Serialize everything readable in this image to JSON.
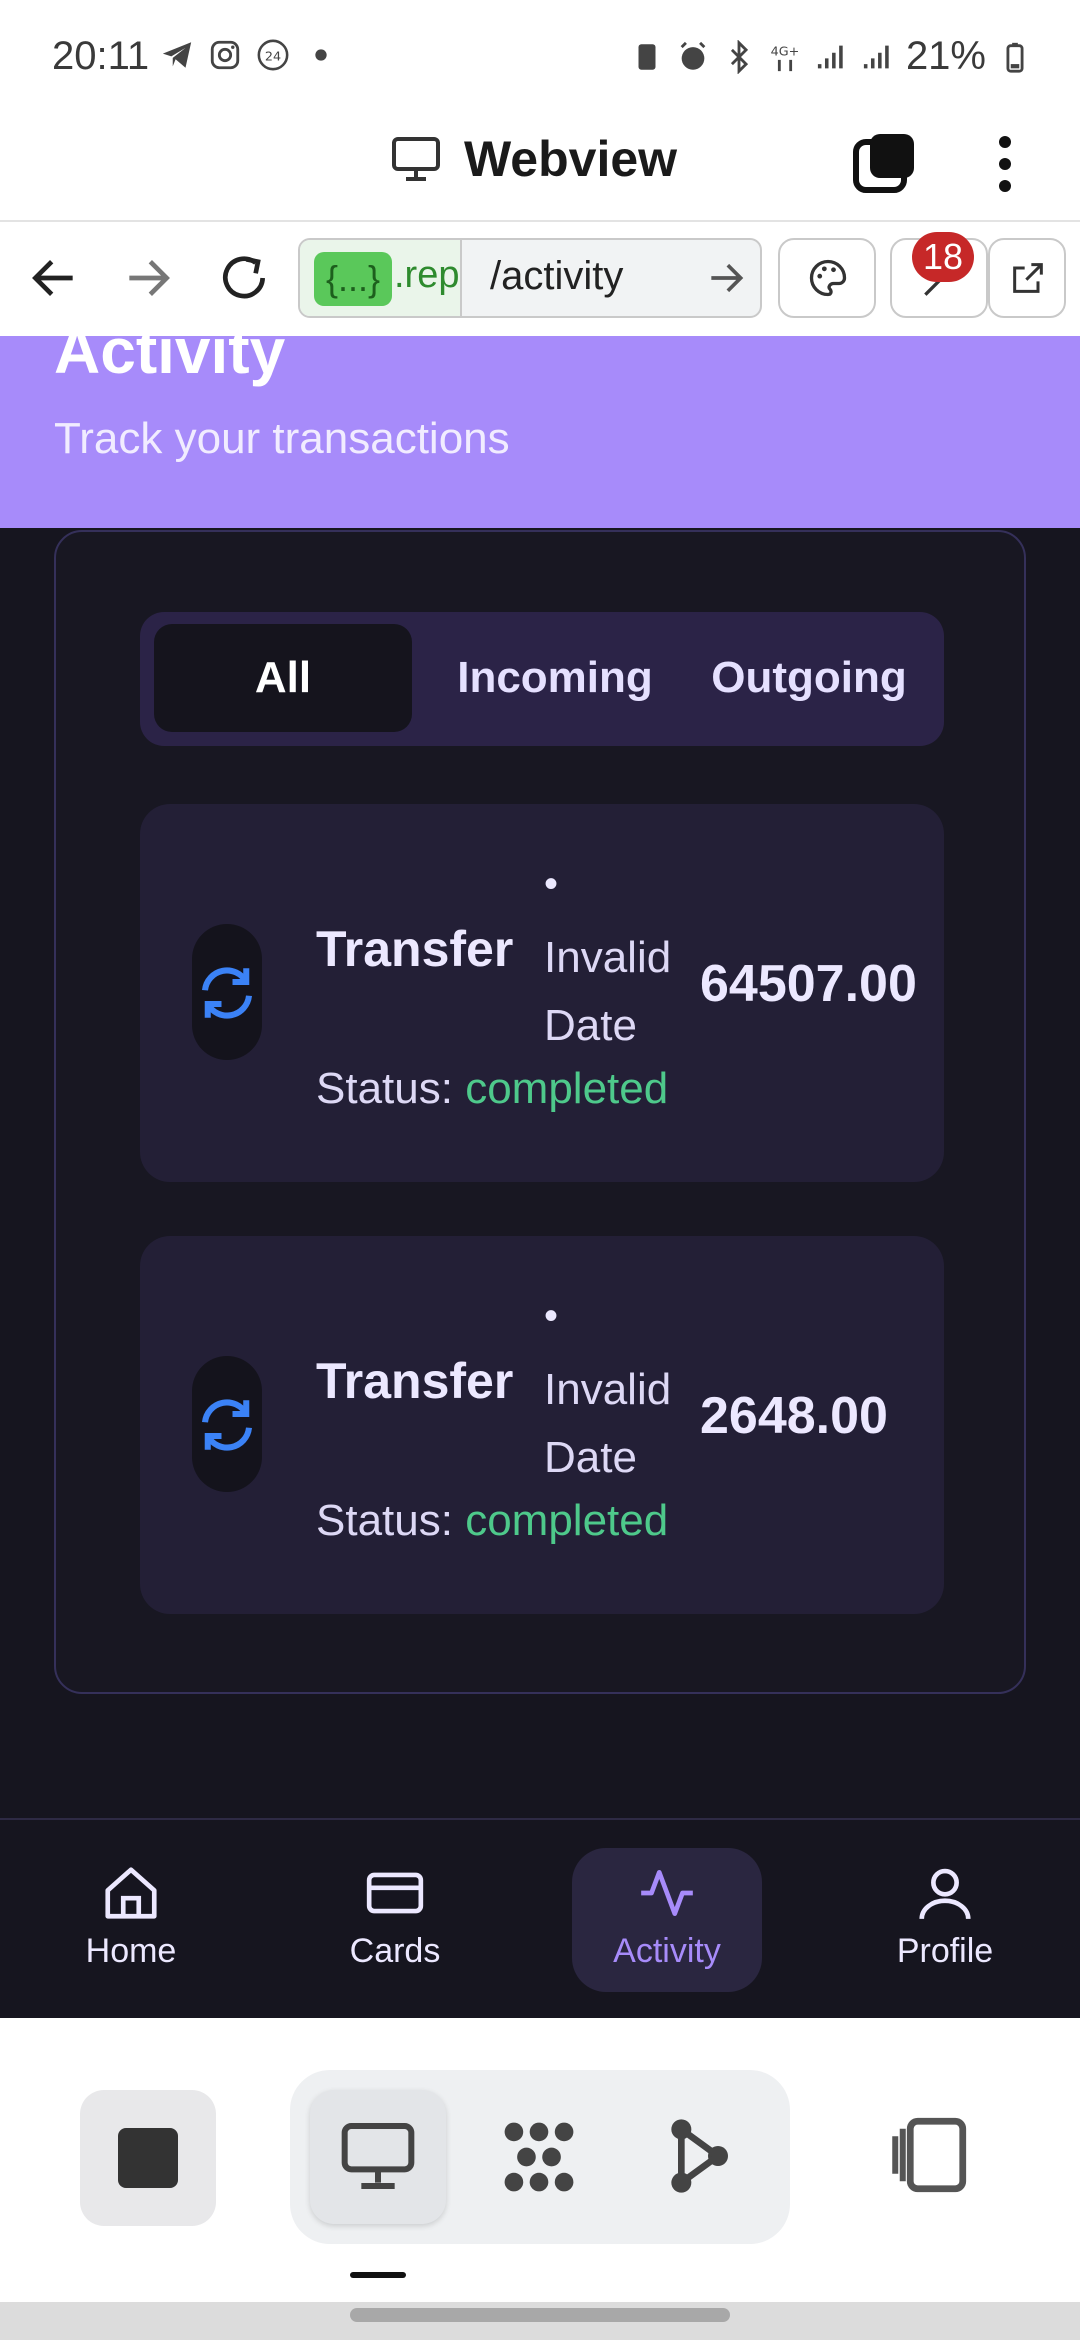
{
  "status_bar": {
    "time": "20:11",
    "battery": "21%",
    "icons": [
      "telegram-icon",
      "instagram-icon",
      "24-hour-icon",
      "dot-icon",
      "battery-saver-icon",
      "alarm-icon",
      "bluetooth-icon",
      "4g-icon",
      "signal-icon",
      "signal-icon",
      "battery-icon"
    ]
  },
  "titlebar": {
    "title": "Webview"
  },
  "urlbar": {
    "host_badge": "{...}",
    "host": ".rep",
    "path": "/activity",
    "notification_count": "18"
  },
  "hero": {
    "title": "Activity",
    "subtitle": "Track your transactions"
  },
  "tabs": [
    {
      "label": "All",
      "active": true
    },
    {
      "label": "Incoming",
      "active": false
    },
    {
      "label": "Outgoing",
      "active": false
    }
  ],
  "transactions": [
    {
      "type": "Transfer",
      "dot": "•",
      "date": "Invalid Date",
      "amount": "64507.00",
      "status_label": "Status:",
      "status": "completed"
    },
    {
      "type": "Transfer",
      "dot": "•",
      "date": "Invalid Date",
      "amount": "2648.00",
      "status_label": "Status:",
      "status": "completed"
    }
  ],
  "bottom_nav": [
    {
      "label": "Home",
      "icon": "home-icon",
      "active": false
    },
    {
      "label": "Cards",
      "icon": "card-icon",
      "active": false
    },
    {
      "label": "Activity",
      "icon": "activity-icon",
      "active": true
    },
    {
      "label": "Profile",
      "icon": "user-icon",
      "active": false
    }
  ],
  "colors": {
    "hero": "#a78bfa",
    "background": "#16151f",
    "card": "#231f36",
    "status_completed": "#4ec98b",
    "accent": "#a78bfa",
    "icon_blue": "#3b82f6"
  }
}
